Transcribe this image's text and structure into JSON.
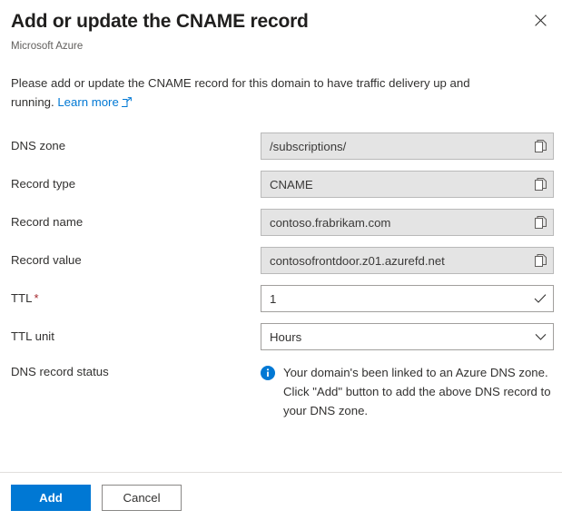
{
  "header": {
    "title": "Add or update the CNAME record",
    "subtitle": "Microsoft Azure",
    "close_icon": "close-icon"
  },
  "description": {
    "text_before_link": "Please add or update the CNAME record for this domain to have traffic delivery up and running.",
    "link_label": "Learn more",
    "link_icon": "external-link-icon"
  },
  "form": {
    "rows": [
      {
        "label": "DNS zone",
        "value": "/subscriptions/",
        "state": "disabled",
        "icon": "copy-icon"
      },
      {
        "label": "Record type",
        "value": "CNAME",
        "state": "disabled",
        "icon": "copy-icon"
      },
      {
        "label": "Record name",
        "value": "contoso.frabrikam.com",
        "state": "disabled",
        "icon": "copy-icon"
      },
      {
        "label": "Record value",
        "value": "contosofrontdoor.z01.azurefd.net",
        "state": "disabled",
        "icon": "copy-icon"
      },
      {
        "label": "TTL",
        "required": true,
        "required_marker": "*",
        "value": "1",
        "state": "editable",
        "icon": "checkmark-icon"
      },
      {
        "label": "TTL unit",
        "value": "Hours",
        "state": "dropdown",
        "icon": "chevron-down-icon",
        "options": [
          "Hours"
        ]
      }
    ],
    "status": {
      "label": "DNS record status",
      "icon": "info-icon",
      "message": "Your domain's been linked to an Azure DNS zone. Click \"Add\" button to add the above DNS record to your DNS zone."
    }
  },
  "footer": {
    "add_label": "Add",
    "cancel_label": "Cancel"
  },
  "colors": {
    "accent": "#0078d4",
    "required": "#a4262c",
    "info": "#0078d4",
    "disabled_field": "#e4e4e4",
    "border": "#a19f9d",
    "text": "#323130",
    "subtle_text": "#605e5c"
  }
}
